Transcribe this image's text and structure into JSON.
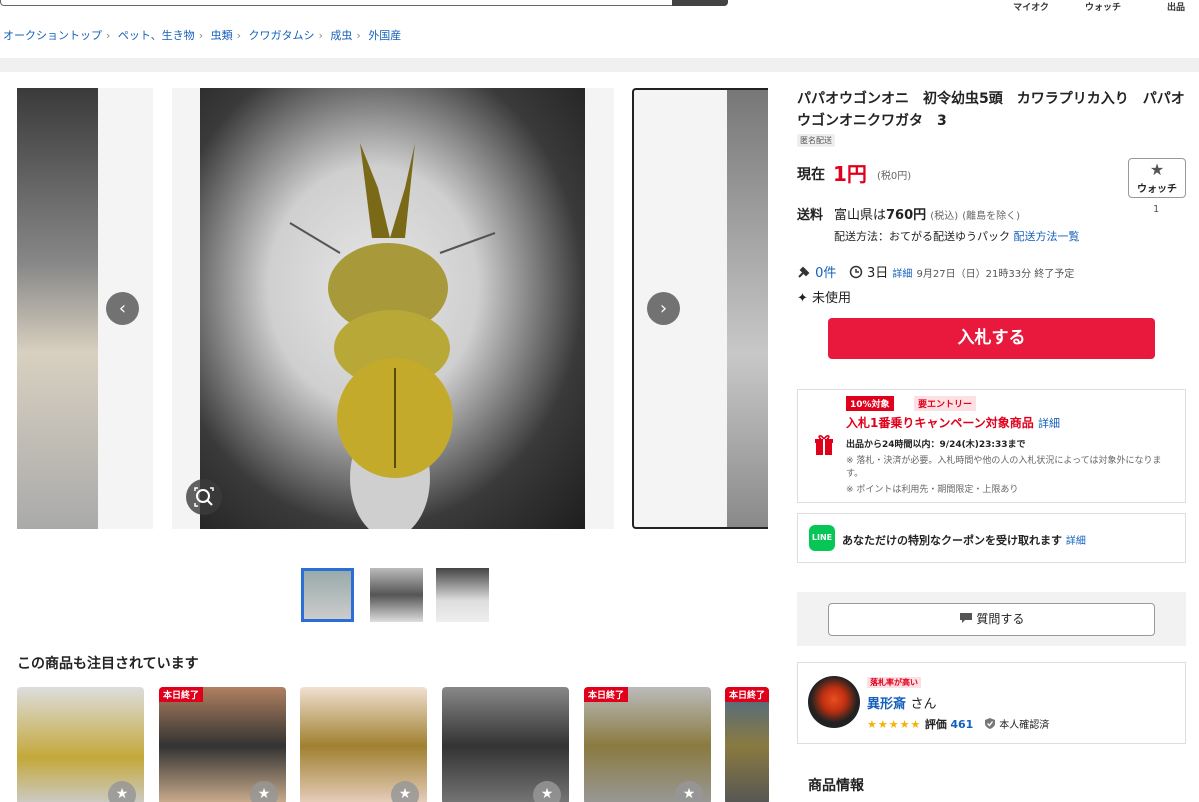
{
  "header": {
    "nav": [
      "マイオク",
      "ウォッチ",
      "出品"
    ]
  },
  "breadcrumb": [
    "オークショントップ",
    "ペット、生き物",
    "虫類",
    "クワガタムシ",
    "成虫",
    "外国産"
  ],
  "gallery": {
    "prev_icon": "chevron-left-icon",
    "next_icon": "chevron-right-icon",
    "prev_glyph": "‹",
    "next_glyph": "›",
    "zoom_icon": "zoom-icon"
  },
  "related": {
    "title": "この商品も注目されています",
    "badge": "本日終了",
    "star": "★"
  },
  "item": {
    "title": "パパオウゴンオニ　初令幼虫5頭　カワラプリカ入り　パパオウゴンオニクワガタ　3",
    "anon": "匿名配送",
    "price_label": "現在",
    "price": "1円",
    "price_tax": "(税0円)",
    "watch_label": "ウォッチ",
    "watch_star": "★",
    "watch_count": "1",
    "ship_label": "送料",
    "ship_prefix": "富山県は",
    "ship_price": "760円",
    "ship_tax": "(税込)",
    "ship_note": "(離島を除く)",
    "ship_method_label": "配送方法：おてがる配送ゆうパック",
    "ship_method_link": "配送方法一覧",
    "bid_icon": "gavel-icon",
    "bids": "0件",
    "time_icon": "clock-icon",
    "time_left": "3日",
    "detail_link": "詳細",
    "end_time": "9月27日（日）21時33分 終了予定",
    "condition": "未使用",
    "bid_button": "入札する"
  },
  "promo": {
    "tag": "10%対象",
    "entry": "要エントリー",
    "title": "入札1番乗りキャンペーン対象商品",
    "detail": "詳細",
    "line1": "出品から24時間以内：9/24(木)23:33まで",
    "line2": "※ 落札・決済が必要。入札時間や他の人の入札状況によっては対象外になります。",
    "line3": "※ ポイントは利用先・期間限定・上限あり"
  },
  "line_coupon": {
    "icon_text": "LINE",
    "text": "あなただけの特別なクーポンを受け取れます",
    "detail": "詳細"
  },
  "question_button": "質問する",
  "seller": {
    "badge": "落札率が高い",
    "name": "異形斎",
    "suffix": "さん",
    "stars": "★★★★★",
    "rating_label": "評価",
    "rating": "461",
    "verified": "本人確認済"
  },
  "section": {
    "product_info": "商品情報"
  }
}
